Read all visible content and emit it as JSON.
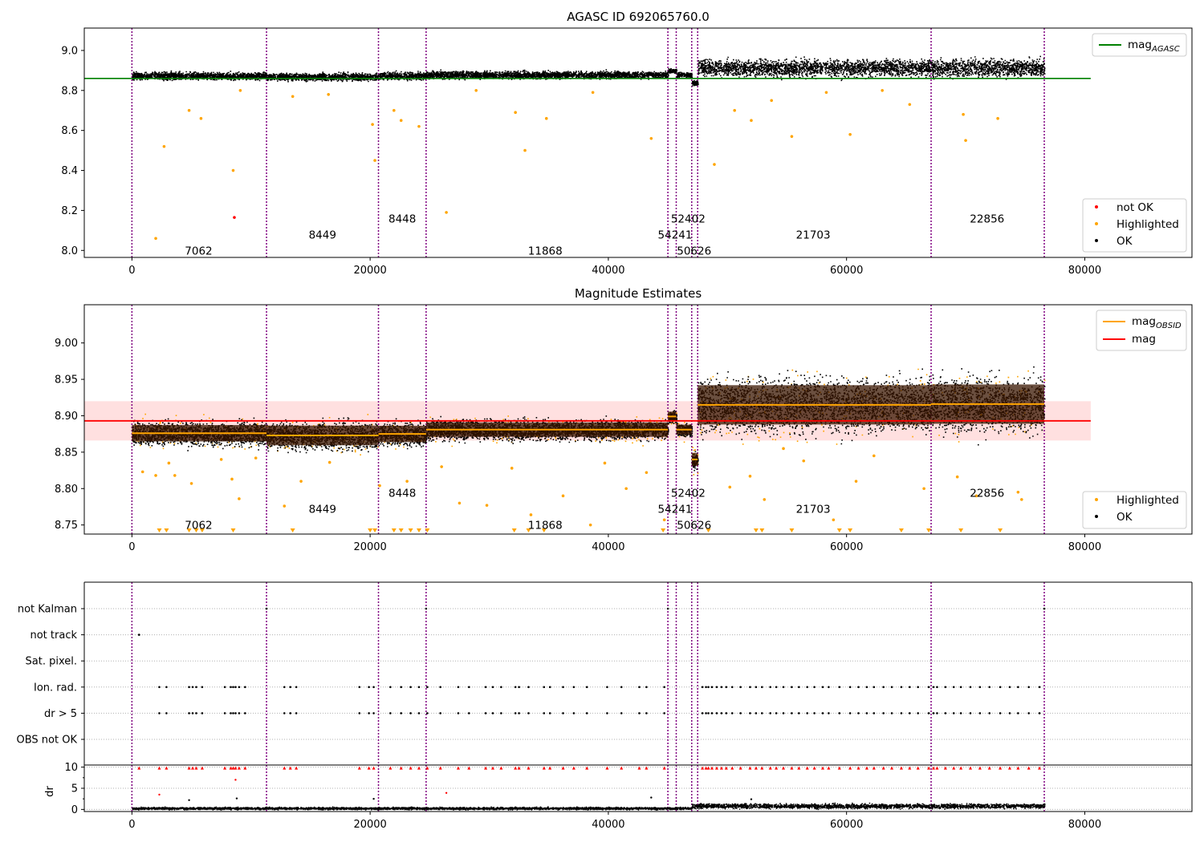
{
  "chart_data": [
    {
      "type": "scatter",
      "title": "AGASC ID 692065760.0",
      "xlabel": "",
      "ylabel": "",
      "xlim": [
        -4000,
        89000
      ],
      "ylim": [
        7.965,
        9.112
      ],
      "xticks": [
        0,
        20000,
        40000,
        60000,
        80000
      ],
      "xtick_labels": [
        "0",
        "20000",
        "40000",
        "60000",
        "80000"
      ],
      "yticks": [
        8.0,
        8.2,
        8.4,
        8.6,
        8.8,
        9.0
      ],
      "ytick_labels": [
        "8.0",
        "8.2",
        "8.4",
        "8.6",
        "8.8",
        "9.0"
      ],
      "grid": false,
      "mag_agasc": 8.86,
      "mag_agasc_xrange": [
        -4000,
        80500
      ],
      "obsid_boundaries": [
        0,
        11300,
        20700,
        24700,
        45000,
        45700,
        47000,
        47500,
        67100,
        76600
      ],
      "obsid_labels": [
        {
          "text": "7062",
          "x": 5600,
          "y": 8.0
        },
        {
          "text": "8449",
          "x": 16000,
          "y": 8.08
        },
        {
          "text": "8448",
          "x": 22700,
          "y": 8.16
        },
        {
          "text": "11868",
          "x": 34700,
          "y": 8.0
        },
        {
          "text": "52402",
          "x": 46700,
          "y": 8.16
        },
        {
          "text": "54241",
          "x": 45600,
          "y": 8.08
        },
        {
          "text": "50626",
          "x": 47200,
          "y": 8.0
        },
        {
          "text": "21703",
          "x": 57200,
          "y": 8.08
        },
        {
          "text": "22856",
          "x": 71800,
          "y": 8.16
        }
      ],
      "legend_upper": {
        "position": "top-right",
        "entries": [
          {
            "label": "mag",
            "subscript": "AGASC",
            "color": "#008000"
          }
        ]
      },
      "legend_lower": {
        "position": "bottom-right",
        "entries": [
          {
            "label": "not OK",
            "color": "#ff0000"
          },
          {
            "label": "Highlighted",
            "color": "#ffa500"
          },
          {
            "label": "OK",
            "color": "#000000"
          }
        ]
      },
      "ok_segments": [
        {
          "x0": 0,
          "x1": 11300,
          "center": 8.875,
          "spread": 0.03
        },
        {
          "x0": 11300,
          "x1": 20700,
          "center": 8.87,
          "spread": 0.03
        },
        {
          "x0": 20700,
          "x1": 24700,
          "center": 8.875,
          "spread": 0.03
        },
        {
          "x0": 24700,
          "x1": 45000,
          "center": 8.88,
          "spread": 0.03
        },
        {
          "x0": 45000,
          "x1": 45700,
          "center": 8.9,
          "spread": 0.02
        },
        {
          "x0": 45700,
          "x1": 47000,
          "center": 8.88,
          "spread": 0.02
        },
        {
          "x0": 47000,
          "x1": 47500,
          "center": 8.84,
          "spread": 0.02
        },
        {
          "x0": 47500,
          "x1": 67100,
          "center": 8.915,
          "spread": 0.07
        },
        {
          "x0": 67100,
          "x1": 76600,
          "center": 8.915,
          "spread": 0.07
        }
      ],
      "highlighted_points": [
        [
          2700,
          8.52
        ],
        [
          8500,
          8.4
        ],
        [
          2000,
          8.06
        ],
        [
          5800,
          8.66
        ],
        [
          9100,
          8.8
        ],
        [
          13500,
          8.77
        ],
        [
          20200,
          8.63
        ],
        [
          20400,
          8.45
        ],
        [
          22000,
          8.7
        ],
        [
          22600,
          8.65
        ],
        [
          24100,
          8.62
        ],
        [
          26400,
          8.19
        ],
        [
          33000,
          8.5
        ],
        [
          32200,
          8.69
        ],
        [
          34800,
          8.66
        ],
        [
          43600,
          8.56
        ],
        [
          48900,
          8.43
        ],
        [
          52000,
          8.65
        ],
        [
          55400,
          8.57
        ],
        [
          60300,
          8.58
        ],
        [
          65300,
          8.73
        ],
        [
          70000,
          8.55
        ],
        [
          72700,
          8.66
        ],
        [
          4800,
          8.7
        ],
        [
          16500,
          8.78
        ],
        [
          28900,
          8.8
        ],
        [
          38700,
          8.79
        ],
        [
          50600,
          8.7
        ],
        [
          53700,
          8.75
        ],
        [
          58300,
          8.79
        ],
        [
          63000,
          8.8
        ],
        [
          69800,
          8.68
        ]
      ],
      "not_ok_points": [
        [
          8600,
          8.165
        ]
      ]
    },
    {
      "type": "scatter",
      "title": "Magnitude Estimates",
      "xlabel": "",
      "ylabel": "",
      "xlim": [
        -4000,
        89000
      ],
      "ylim": [
        8.7375,
        9.0525
      ],
      "xticks": [
        0,
        20000,
        40000,
        60000,
        80000
      ],
      "xtick_labels": [
        "0",
        "20000",
        "40000",
        "60000",
        "80000"
      ],
      "yticks": [
        8.75,
        8.8,
        8.85,
        8.9,
        8.95,
        9.0
      ],
      "ytick_labels": [
        "8.75",
        "8.80",
        "8.85",
        "8.90",
        "8.95",
        "9.00"
      ],
      "grid": false,
      "mag": 8.893,
      "mag_band": [
        8.866,
        8.92
      ],
      "mag_xrange": [
        -4000,
        80500
      ],
      "obsid_boundaries": [
        0,
        11300,
        20700,
        24700,
        45000,
        45700,
        47000,
        47500,
        67100,
        76600
      ],
      "obsid_labels": [
        {
          "text": "7062",
          "x": 5600,
          "y": 8.75
        },
        {
          "text": "8449",
          "x": 16000,
          "y": 8.772
        },
        {
          "text": "8448",
          "x": 22700,
          "y": 8.794
        },
        {
          "text": "11868",
          "x": 34700,
          "y": 8.75
        },
        {
          "text": "52402",
          "x": 46700,
          "y": 8.794
        },
        {
          "text": "54241",
          "x": 45600,
          "y": 8.772
        },
        {
          "text": "50626",
          "x": 47200,
          "y": 8.75
        },
        {
          "text": "21703",
          "x": 57200,
          "y": 8.772
        },
        {
          "text": "22856",
          "x": 71800,
          "y": 8.794
        }
      ],
      "mag_obsid": [
        {
          "x0": 0,
          "x1": 11300,
          "value": 8.876
        },
        {
          "x0": 11300,
          "x1": 20700,
          "value": 8.873
        },
        {
          "x0": 20700,
          "x1": 24700,
          "value": 8.875
        },
        {
          "x0": 24700,
          "x1": 45000,
          "value": 8.881
        },
        {
          "x0": 45000,
          "x1": 45700,
          "value": 8.899
        },
        {
          "x0": 45700,
          "x1": 47000,
          "value": 8.881
        },
        {
          "x0": 47000,
          "x1": 47500,
          "value": 8.84
        },
        {
          "x0": 47500,
          "x1": 67100,
          "value": 8.915
        },
        {
          "x0": 67100,
          "x1": 76600,
          "value": 8.916
        }
      ],
      "legend_upper": {
        "position": "top-right",
        "entries": [
          {
            "label": "mag",
            "subscript": "OBSID",
            "color": "#ffa500"
          },
          {
            "label": "mag",
            "subscript": "",
            "color": "#ff0000"
          }
        ]
      },
      "legend_lower": {
        "position": "bottom-right",
        "entries": [
          {
            "label": "Highlighted",
            "color": "#ffa500"
          },
          {
            "label": "OK",
            "color": "#000000"
          }
        ]
      },
      "ok_segments": [
        {
          "x0": 0,
          "x1": 11300,
          "center": 8.876,
          "spread": 0.025
        },
        {
          "x0": 11300,
          "x1": 20700,
          "center": 8.873,
          "spread": 0.03
        },
        {
          "x0": 20700,
          "x1": 24700,
          "center": 8.875,
          "spread": 0.025
        },
        {
          "x0": 24700,
          "x1": 45000,
          "center": 8.881,
          "spread": 0.022
        },
        {
          "x0": 45000,
          "x1": 45700,
          "center": 8.899,
          "spread": 0.015
        },
        {
          "x0": 45700,
          "x1": 47000,
          "center": 8.881,
          "spread": 0.015
        },
        {
          "x0": 47000,
          "x1": 47500,
          "center": 8.84,
          "spread": 0.02
        },
        {
          "x0": 47500,
          "x1": 67100,
          "center": 8.915,
          "spread": 0.06
        },
        {
          "x0": 67100,
          "x1": 76600,
          "center": 8.916,
          "spread": 0.06
        }
      ],
      "highlighted_points": [
        [
          900,
          8.823
        ],
        [
          2000,
          8.818
        ],
        [
          3600,
          8.818
        ],
        [
          5000,
          8.807
        ],
        [
          8400,
          8.813
        ],
        [
          9000,
          8.786
        ],
        [
          14200,
          8.81
        ],
        [
          12800,
          8.776
        ],
        [
          20800,
          8.804
        ],
        [
          23100,
          8.81
        ],
        [
          27500,
          8.78
        ],
        [
          29800,
          8.777
        ],
        [
          33500,
          8.764
        ],
        [
          36200,
          8.79
        ],
        [
          38500,
          8.75
        ],
        [
          41500,
          8.8
        ],
        [
          44700,
          8.757
        ],
        [
          50200,
          8.802
        ],
        [
          51900,
          8.817
        ],
        [
          53100,
          8.785
        ],
        [
          56400,
          8.838
        ],
        [
          58900,
          8.757
        ],
        [
          60800,
          8.81
        ],
        [
          66500,
          8.8
        ],
        [
          69300,
          8.816
        ],
        [
          70900,
          8.79
        ],
        [
          74400,
          8.795
        ],
        [
          74700,
          8.785
        ],
        [
          3100,
          8.835
        ],
        [
          7500,
          8.84
        ],
        [
          10400,
          8.842
        ],
        [
          16600,
          8.836
        ],
        [
          26000,
          8.83
        ],
        [
          31900,
          8.828
        ],
        [
          39700,
          8.835
        ],
        [
          43200,
          8.822
        ],
        [
          54700,
          8.855
        ],
        [
          62300,
          8.845
        ]
      ],
      "clipped_points_x": [
        2300,
        2900,
        4800,
        5400,
        5900,
        8500,
        13500,
        20000,
        20400,
        22000,
        22600,
        23400,
        24100,
        24800,
        32100,
        33300,
        34600,
        44600,
        48400,
        52400,
        52900,
        55400,
        59400,
        60300,
        64600,
        66900,
        69600,
        72900
      ]
    },
    {
      "type": "scatter",
      "title": "",
      "xlabel": "",
      "ylabel": "",
      "xlim": [
        -4000,
        89000
      ],
      "xticks": [
        0,
        20000,
        40000,
        60000,
        80000
      ],
      "xtick_labels": [
        "0",
        "20000",
        "40000",
        "60000",
        "80000"
      ],
      "grid": true,
      "categories": [
        "not Kalman",
        "not track",
        "Sat. pixel.",
        "Ion. rad.",
        "dr > 5",
        "OBS not OK"
      ],
      "obsid_boundaries": [
        0,
        11300,
        20700,
        24700,
        45000,
        45700,
        47000,
        47500,
        67100,
        76600
      ],
      "flag_points": {
        "not Kalman": [
          11300,
          24700,
          45000,
          76600
        ],
        "not track": [
          600
        ],
        "Sat. pixel.": [],
        "Ion. rad.": [
          2300,
          2900,
          4800,
          5100,
          5400,
          5900,
          7800,
          8300,
          8500,
          8700,
          9000,
          9500,
          12800,
          13300,
          13800,
          19100,
          19900,
          20300,
          21700,
          22600,
          23400,
          24100,
          24800,
          25900,
          27400,
          28300,
          29700,
          30300,
          31000,
          32200,
          32500,
          33300,
          34600,
          35100,
          36200,
          37100,
          38200,
          39900,
          41100,
          42600,
          43200,
          44700,
          47900,
          48200,
          48400,
          48700,
          49100,
          49500,
          49900,
          50400,
          51100,
          51900,
          52400,
          52900,
          53600,
          54100,
          54700,
          55400,
          56000,
          56700,
          57300,
          58000,
          58500,
          59400,
          60300,
          61000,
          61700,
          62300,
          63100,
          63800,
          64600,
          65300,
          66000,
          66900,
          67300,
          67600,
          68300,
          69000,
          69600,
          70400,
          71200,
          72000,
          72900,
          73700,
          74400,
          75300,
          76200
        ],
        "dr > 5": [
          2300,
          2900,
          4800,
          5100,
          5400,
          5900,
          7800,
          8300,
          8500,
          8700,
          9000,
          9500,
          12800,
          13300,
          13800,
          19100,
          19900,
          20300,
          21700,
          22600,
          23400,
          24100,
          24800,
          25900,
          27400,
          28300,
          29700,
          30300,
          31000,
          32200,
          32500,
          33300,
          34600,
          35100,
          36200,
          37100,
          38200,
          39900,
          41100,
          42600,
          43200,
          44700,
          47900,
          48200,
          48400,
          48700,
          49100,
          49500,
          49900,
          50400,
          51100,
          51900,
          52400,
          52900,
          53600,
          54100,
          54700,
          55400,
          56000,
          56700,
          57300,
          58000,
          58500,
          59400,
          60300,
          61000,
          61700,
          62300,
          63100,
          63800,
          64600,
          65300,
          66000,
          66900,
          67300,
          67600,
          68300,
          69000,
          69600,
          70400,
          71200,
          72000,
          72900,
          73700,
          74400,
          75300,
          76200
        ],
        "OBS not OK": []
      }
    },
    {
      "type": "scatter",
      "title": "",
      "xlabel": "",
      "ylabel": "dr",
      "xlim": [
        -4000,
        89000
      ],
      "ylim": [
        -0.5,
        10.5
      ],
      "xticks": [
        0,
        20000,
        40000,
        60000,
        80000
      ],
      "xtick_labels": [
        "0",
        "20000",
        "40000",
        "60000",
        "80000"
      ],
      "yticks": [
        0,
        5,
        10
      ],
      "ytick_labels": [
        "0",
        "5",
        "10"
      ],
      "grid": true,
      "obsid_boundaries": [
        0,
        11300,
        20700,
        24700,
        45000,
        45700,
        47000,
        47500,
        67100,
        76600
      ],
      "dr_baseline": [
        {
          "x0": 0,
          "x1": 47000,
          "center": 0.35,
          "spread": 0.45
        },
        {
          "x0": 47000,
          "x1": 76600,
          "center": 0.9,
          "spread": 0.9
        }
      ],
      "dr_outliers": [
        [
          2300,
          3.5
        ],
        [
          4800,
          2.2
        ],
        [
          8700,
          7.0
        ],
        [
          8800,
          2.6
        ],
        [
          20300,
          2.5
        ],
        [
          26400,
          3.9
        ],
        [
          43600,
          2.8
        ],
        [
          52000,
          2.4
        ]
      ],
      "clipped_x": [
        600,
        2300,
        2900,
        4800,
        5100,
        5400,
        5900,
        7800,
        8300,
        8500,
        8700,
        9000,
        9500,
        12800,
        13300,
        13800,
        19100,
        19900,
        20300,
        21700,
        22600,
        23400,
        24100,
        24800,
        25900,
        27400,
        28300,
        29700,
        30300,
        31000,
        32200,
        32500,
        33300,
        34600,
        35100,
        36200,
        37100,
        38200,
        39900,
        41100,
        42600,
        43200,
        44700,
        47900,
        48200,
        48400,
        48700,
        49100,
        49500,
        49900,
        50400,
        51100,
        51900,
        52400,
        52900,
        53600,
        54100,
        54700,
        55400,
        56000,
        56700,
        57300,
        58000,
        58500,
        59400,
        60300,
        61000,
        61700,
        62300,
        63100,
        63800,
        64600,
        65300,
        66000,
        66900,
        67300,
        67600,
        68300,
        69000,
        69600,
        70400,
        71200,
        72000,
        72900,
        73700,
        74400,
        75300,
        76200
      ]
    }
  ]
}
